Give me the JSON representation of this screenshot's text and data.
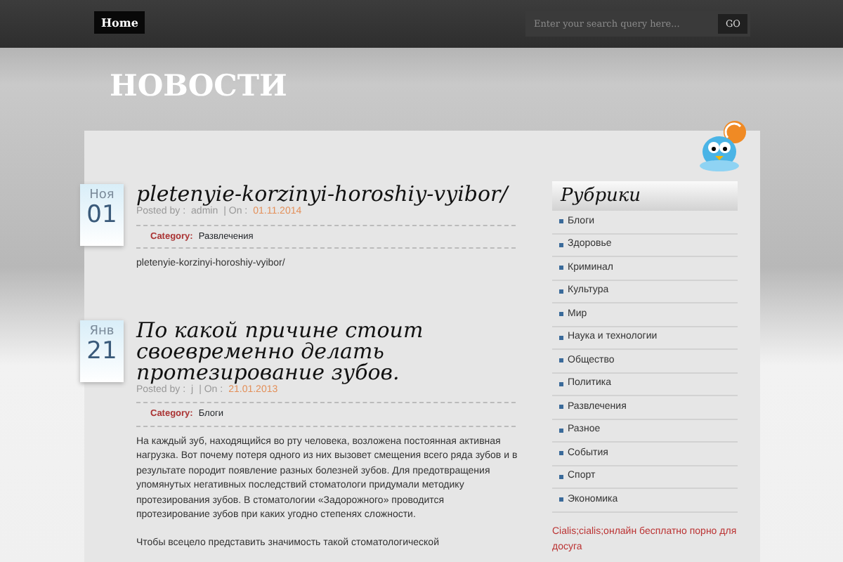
{
  "topbar": {
    "nav": [
      {
        "label": "Home",
        "selected": true
      }
    ],
    "search": {
      "placeholder": "Enter your search query here...",
      "button": "GO"
    }
  },
  "site_title": "НОВОСТИ",
  "posts": [
    {
      "month": "Ноя",
      "day": "01",
      "title": "pletenyie-korzinyi-horoshiy-vyibor/",
      "posted_by": "Posted by :",
      "author": "admin",
      "on": "| On :",
      "date": "01.11.2014",
      "category_label": "Category:",
      "category": "Развлечения",
      "paragraphs": [
        {
          "before": "pletenyie-korzinyi-horoshiy-vyibor/"
        }
      ]
    },
    {
      "month": "Янв",
      "day": "21",
      "title": "По какой причине стоит своевременно делать протезирование зубов.",
      "posted_by": "Posted by :",
      "author": "j",
      "on": "| On :",
      "date": "21.01.2013",
      "category_label": "Category:",
      "category": "Блоги",
      "paragraphs": [
        {
          "before": "На каждый зуб, находящийся во рту человека, возложена постоянная активная нагрузка. Вот почему потеря одного из них вызовет смещения всего ряда зубов и в результате породит появление разных болезней зубов. Для предотвращения упомянутых негативных последствий стоматологи придумали методику протезирования зубов. В стоматологии «Задорожного» проводится ",
          "link": "протезирование зубов",
          "after": " при каких угодно степенях сложности."
        },
        {
          "before": "Чтобы всецело представить значимость такой стоматологической"
        }
      ]
    }
  ],
  "sidebar": {
    "title": "Рубрики",
    "items": [
      "Блоги",
      "Здоровье",
      "Криминал",
      "Культура",
      "Мир",
      "Наука и технологии",
      "Общество",
      "Политика",
      "Развлечения",
      "Разное",
      "События",
      "Спорт",
      "Экономика"
    ],
    "link": "Cialis;cialis;онлайн бесплатно порно для досуга"
  }
}
